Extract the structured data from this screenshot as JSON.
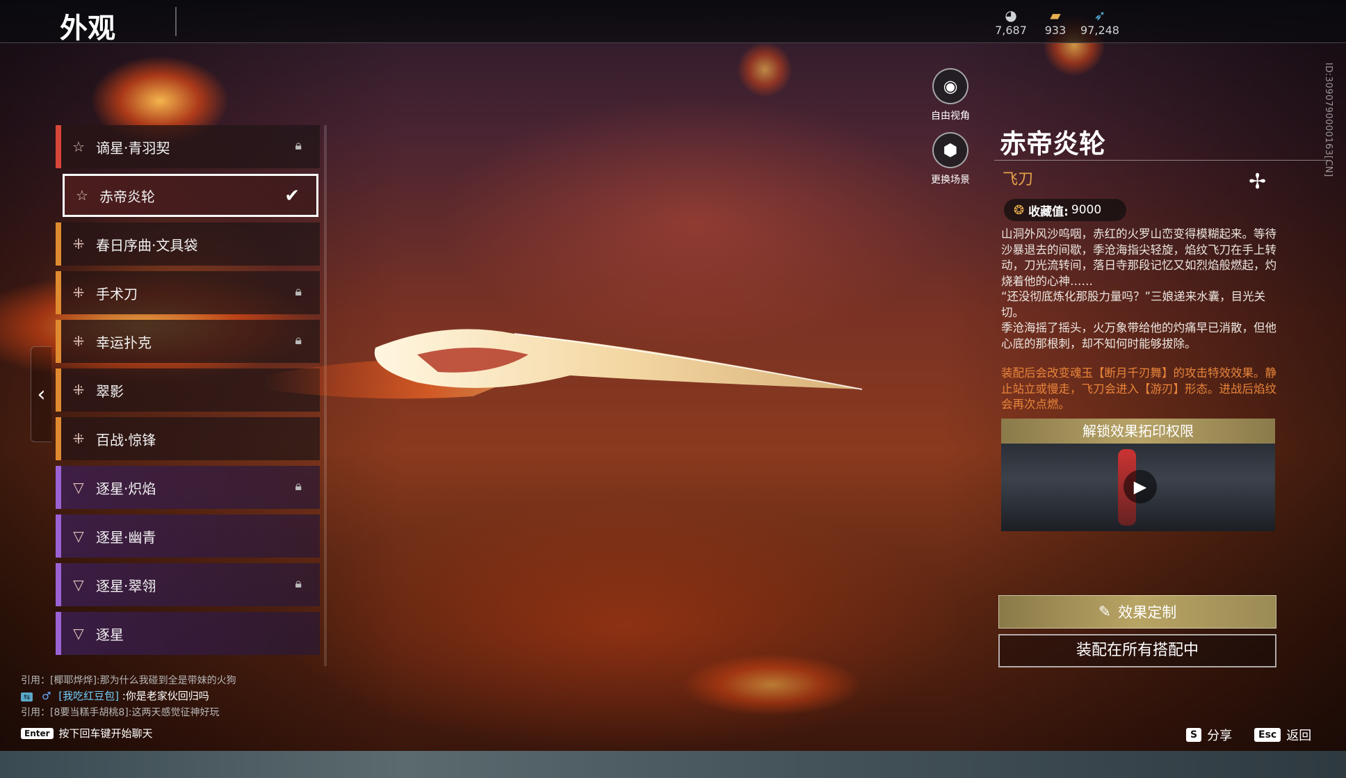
{
  "header": {
    "title": "外观",
    "currencies": [
      {
        "icon": "egg-currency-icon",
        "value": "7,687"
      },
      {
        "icon": "chest-currency-icon",
        "value": "933"
      },
      {
        "icon": "feather-currency-icon",
        "value": "97,248"
      }
    ]
  },
  "items": [
    {
      "label": "谪星·青羽契",
      "rarity": "red",
      "locked": true,
      "selected": false
    },
    {
      "label": "赤帝炎轮",
      "rarity": "red",
      "locked": false,
      "selected": true
    },
    {
      "label": "春日序曲·文具袋",
      "rarity": "orange",
      "locked": false,
      "selected": false
    },
    {
      "label": "手术刀",
      "rarity": "orange",
      "locked": true,
      "selected": false
    },
    {
      "label": "幸运扑克",
      "rarity": "orange",
      "locked": true,
      "selected": false
    },
    {
      "label": "翠影",
      "rarity": "orange",
      "locked": false,
      "selected": false
    },
    {
      "label": "百战·惊锋",
      "rarity": "orange",
      "locked": false,
      "selected": false
    },
    {
      "label": "逐星·炽焰",
      "rarity": "purple",
      "locked": true,
      "selected": false
    },
    {
      "label": "逐星·幽青",
      "rarity": "purple",
      "locked": false,
      "selected": false
    },
    {
      "label": "逐星·翠翎",
      "rarity": "purple",
      "locked": true,
      "selected": false
    },
    {
      "label": "逐星",
      "rarity": "purple",
      "locked": false,
      "selected": false
    }
  ],
  "camera": {
    "free_view": "自由视角",
    "change_scene": "更换场景"
  },
  "detail": {
    "name": "赤帝炎轮",
    "type": "飞刀",
    "collect_label": "收藏值:",
    "collect_value": "9000",
    "description": "山洞外风沙呜咽，赤红的火罗山峦变得模糊起来。等待沙暴退去的间歇，季沧海指尖轻旋，焰纹飞刀在手上转动，刀光流转间，落日寺那段记忆又如烈焰般燃起，灼烧着他的心神……\n“还没彻底炼化那股力量吗？”三娘递来水囊，目光关切。\n季沧海摇了摇头，火万象带给他的灼痛早已消散，但他心底的那根刺，却不知何时能够拔除。",
    "effect": "装配后会改变魂玉【断月千刃舞】的攻击特效效果。静止站立或慢走，飞刀会进入【游刃】形态。进战后焰纹会再次点燃。",
    "preview_title": "解锁效果拓印权限",
    "customize_label": "效果定制",
    "equip_label": "装配在所有搭配中",
    "id_text": "ID:3090790000163[CN]"
  },
  "chat": {
    "lines": [
      "引用：[椰耶烨烨]:那为什么我碰到全是带妹的火狗",
      "引用：[8要当糕手胡桃8]:这两天感觉征神好玩"
    ],
    "main_name": "[我吃红豆包]",
    "main_text": ":你是老家伙回归吗",
    "enter_key": "Enter",
    "enter_hint": "按下回车键开始聊天"
  },
  "hints": {
    "share_key": "S",
    "share_label": "分享",
    "back_key": "Esc",
    "back_label": "返回"
  },
  "colors": {
    "rarity_red": "#d8463a",
    "rarity_orange": "#e08a30",
    "rarity_purple": "#9a62d4",
    "accent_gold": "#b8a464"
  }
}
